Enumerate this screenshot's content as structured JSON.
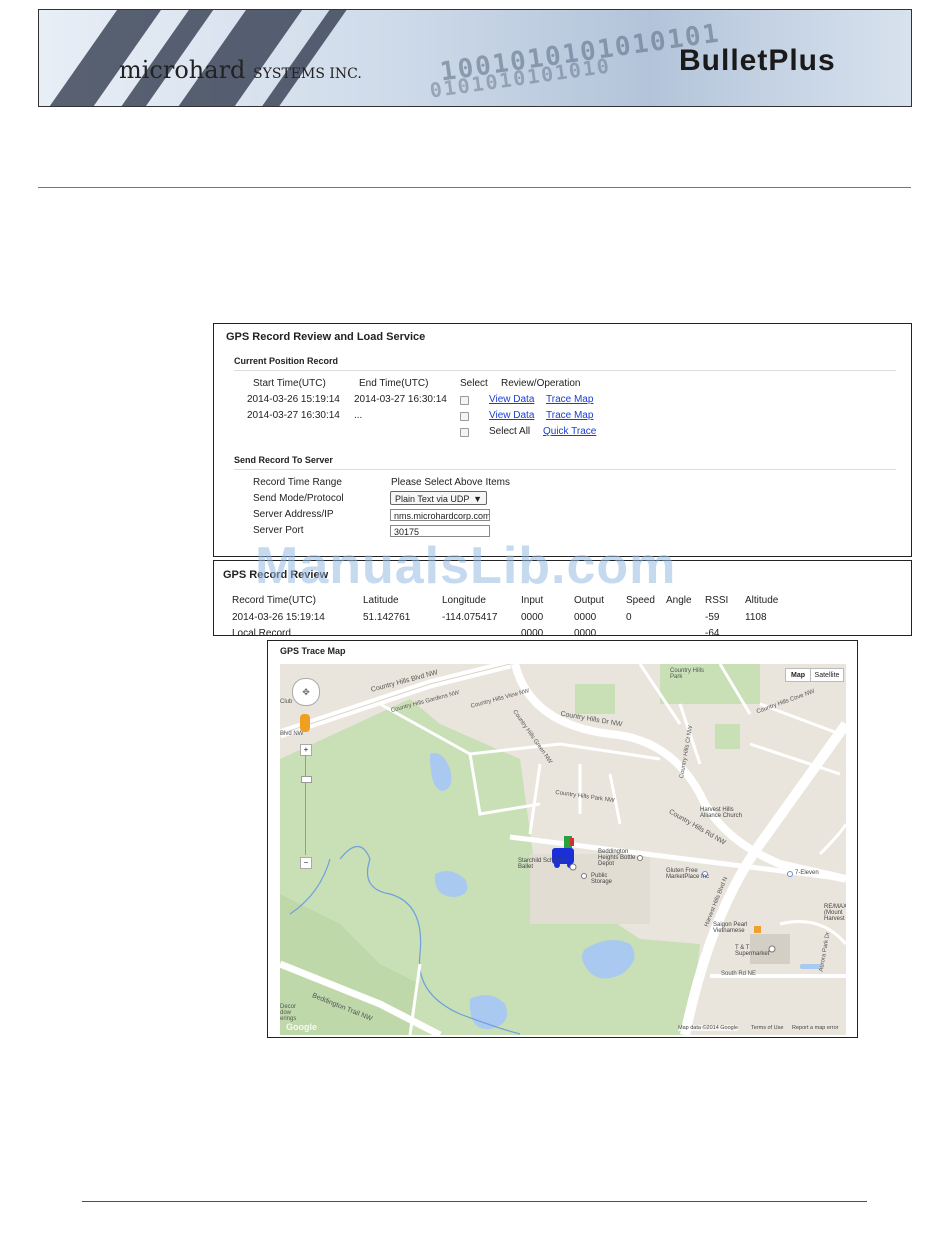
{
  "header": {
    "brand": "microhard",
    "brand_suffix": "SYSTEMS INC.",
    "product": "BulletPlus",
    "binary_1": "1001010101010101",
    "binary_2": "0101010101010"
  },
  "gps_record": {
    "title": "GPS Record Review and Load Service",
    "current_section": "Current Position Record",
    "columns": [
      "Start Time(UTC)",
      "End Time(UTC)",
      "Select",
      "Review/Operation"
    ],
    "rows": [
      {
        "start": "2014-03-26 15:19:14",
        "end": "2014-03-27 16:30:14",
        "view": "View Data",
        "trace": "Trace Map"
      },
      {
        "start": "2014-03-27 16:30:14",
        "end": "...",
        "view": "View Data",
        "trace": "Trace Map"
      }
    ],
    "select_all": "Select All",
    "quick_trace": "Quick Trace",
    "send_section": "Send Record To Server",
    "send_labels": {
      "time_range": "Record Time Range",
      "mode": "Send Mode/Protocol",
      "address": "Server Address/IP",
      "port": "Server Port"
    },
    "send_values": {
      "time_range": "Please Select Above Items",
      "mode": "Plain Text via UDP",
      "address": "nms.microhardcorp.com",
      "port": "30175"
    }
  },
  "gps_reader": {
    "title": "GPS Record Review",
    "columns": [
      "Record Time(UTC)",
      "Latitude",
      "Longitude",
      "Input",
      "Output",
      "Speed",
      "Angle",
      "RSSI",
      "Altitude"
    ],
    "row": [
      "2014-03-26 15:19:14",
      "51.142761",
      "-114.075417",
      "0000",
      "0000",
      "0",
      "",
      "-59",
      "1108"
    ],
    "row2": [
      "Local Record",
      "",
      "",
      "0000",
      "0000",
      "",
      "",
      "-64",
      ""
    ]
  },
  "watermark": "ManualsLib.com",
  "trace_map": {
    "title": "GPS Trace Map",
    "map_btn": "Map",
    "satellite_btn": "Satellite",
    "footer": [
      "Map data ©2014 Google",
      "Terms of Use",
      "Report a map error"
    ],
    "google": "Google",
    "labels": {
      "country_hills_blvd": "Country Hills Blvd NW",
      "country_hills_gardens": "Country Hills Gardens NW",
      "country_hills_view": "Country Hills View NW",
      "country_hills_green": "Country Hills Green NW",
      "country_hills_dr": "Country Hills Dr NW",
      "country_hills_park": "Country Hills Park NW",
      "country_hills_rd": "Country Hills Rd NW",
      "country_hills_cove": "Country Hills Cove NW",
      "country_hills_ct": "Country Hills Ct NW",
      "country_park": "Country Hills Park",
      "harvest_hills_church": "Harvest Hills Alliance Church",
      "harvest_hills_blvd": "Harvest Hills Blvd N",
      "seven_eleven": "7-Eleven",
      "starchild": "Starchild School of Ballet",
      "beddington_bottle": "Beddington Heights Bottle Depot",
      "gluten_free": "Gluten Free MarketPlace Inc",
      "public_storage": "Public Storage",
      "saigon_pearl": "Saigon Pearl Vietnamese",
      "tt": "T & T Supermarket",
      "south_rd": "South Rd NE",
      "remax": "RE/MAX (Mount Harvest",
      "aurora": "Aurora Park Dr",
      "beddington_trail": "Beddington Trail NW",
      "blvd_nw": "Blvd NW",
      "club": "Club",
      "decor": "Decor dow erings"
    }
  }
}
